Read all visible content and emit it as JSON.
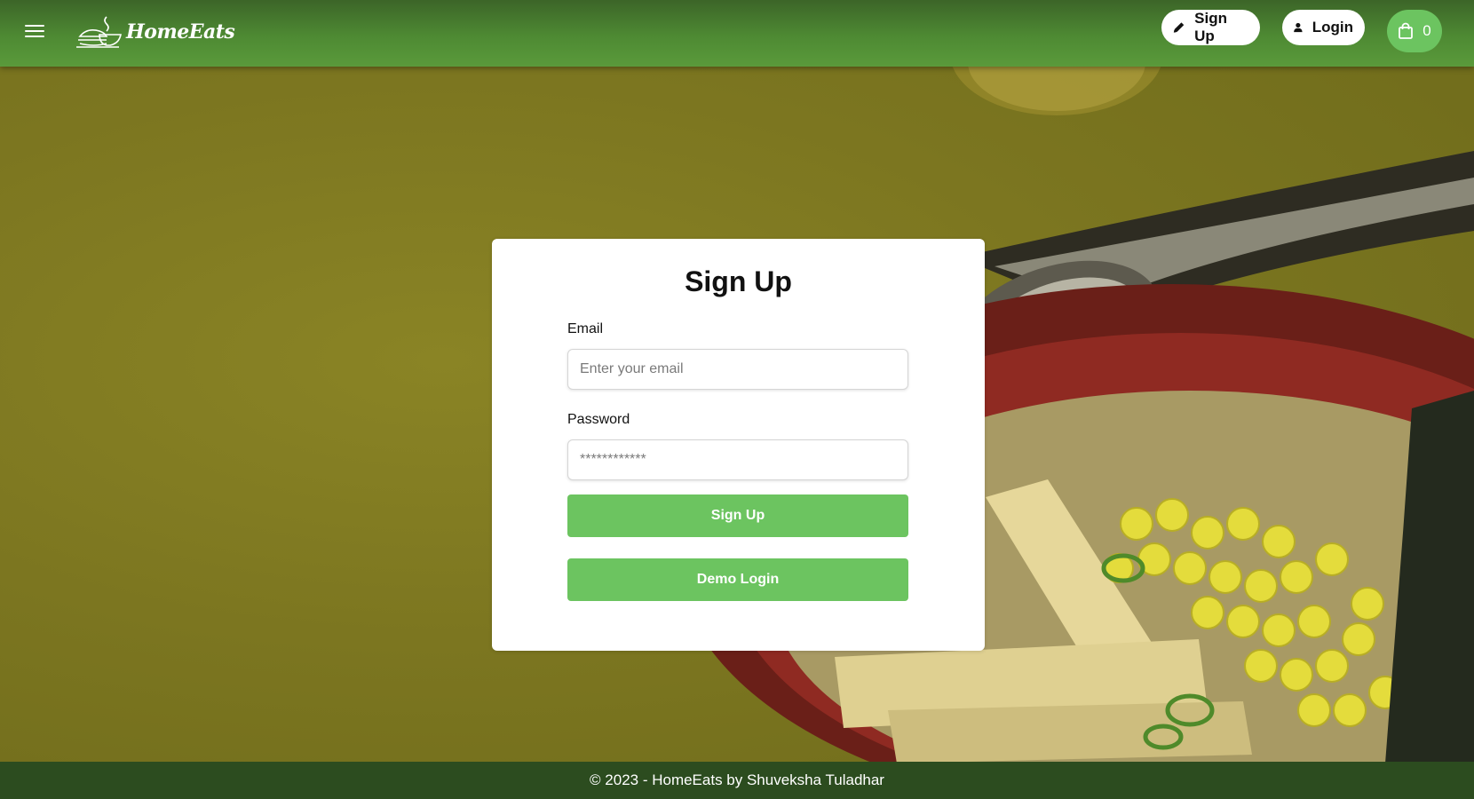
{
  "app": {
    "name": "HomeEats"
  },
  "header": {
    "menu_icon": "hamburger-menu-icon",
    "signup_label": "Sign Up",
    "signup_icon": "pencil-icon",
    "login_label": "Login",
    "login_icon": "user-icon",
    "cart_icon": "shopping-bag-icon",
    "cart_count": "0"
  },
  "form": {
    "title": "Sign Up",
    "email_label": "Email",
    "email_placeholder": "Enter your email",
    "email_value": "",
    "password_label": "Password",
    "password_placeholder": "************",
    "password_value": "",
    "submit_label": "Sign Up",
    "demo_label": "Demo Login"
  },
  "footer": {
    "text": "© 2023 - HomeEats by Shuveksha Tuladhar"
  },
  "colors": {
    "header_green": "#4e8a33",
    "accent_green": "#6cc460",
    "footer_green": "#2c4c1f",
    "background_olive": "#7a7420"
  }
}
